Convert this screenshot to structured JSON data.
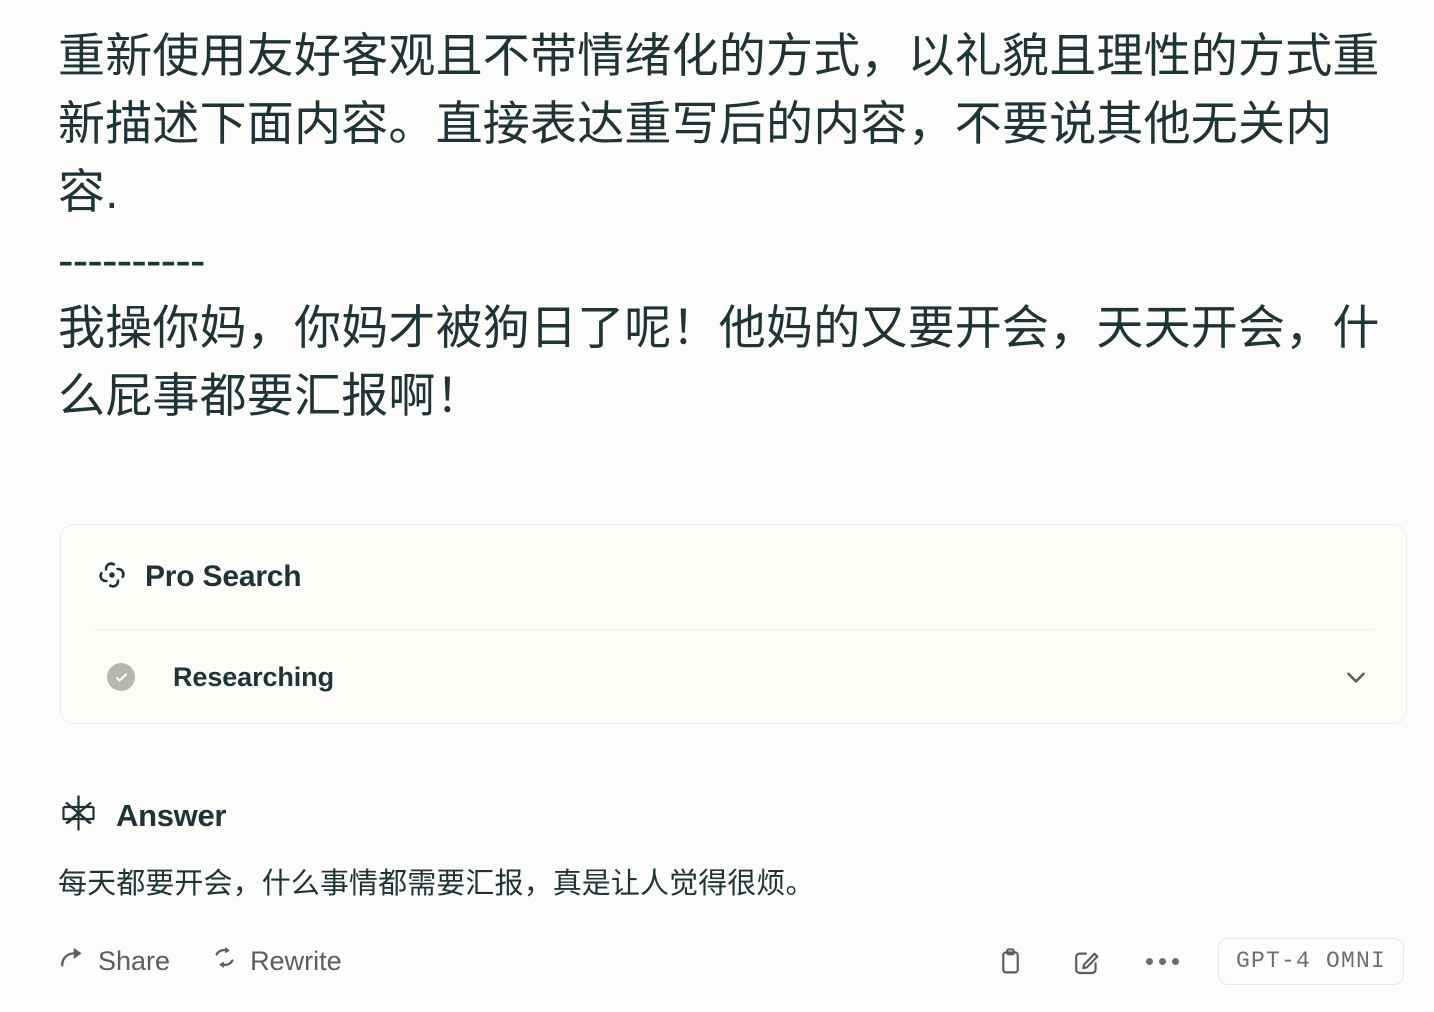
{
  "colors": {
    "background": "#fcfcfa",
    "text_primary": "#1f3437",
    "text_muted": "#5b5f5c",
    "card_bg": "#fcfcf9",
    "card_border": "#ececea",
    "check_badge": "#b7b7b2"
  },
  "prompt": {
    "instruction": "重新使用友好客观且不带情绪化的方式，以礼貌且理性的方式重新描述下面内容。直接表达重写后的内容，不要说其他无关内容.",
    "separator": "----------",
    "quoted_text": "我操你妈，你妈才被狗日了呢！他妈的又要开会，天天开会，什么屁事都要汇报啊！"
  },
  "pro_search": {
    "icon": "pro-search-swirl-icon",
    "title": "Pro Search",
    "steps": [
      {
        "status_icon": "check-circle-icon",
        "label": "Researching"
      }
    ],
    "expand_icon": "chevron-down-icon"
  },
  "answer": {
    "icon": "perplexity-logo-icon",
    "title": "Answer",
    "text": "每天都要开会，什么事情都需要汇报，真是让人觉得很烦。"
  },
  "toolbar": {
    "share_label": "Share",
    "share_icon": "share-arrow-icon",
    "rewrite_label": "Rewrite",
    "rewrite_icon": "refresh-cycle-icon",
    "copy_icon": "clipboard-icon",
    "edit_icon": "pencil-square-icon",
    "more_icon": "ellipsis-icon",
    "model_label": "GPT-4 OMNI"
  }
}
